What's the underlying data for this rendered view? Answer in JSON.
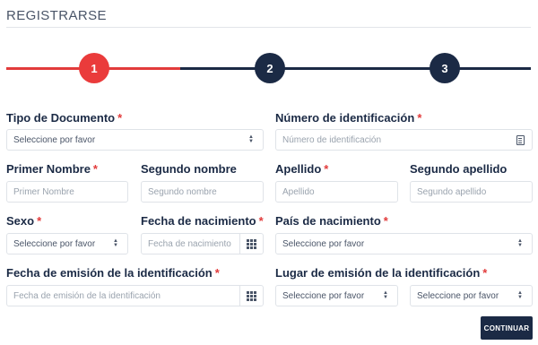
{
  "header": {
    "title": "REGISTRARSE"
  },
  "stepper": {
    "steps": [
      "1",
      "2",
      "3"
    ],
    "current_step": 1
  },
  "required_mark": "*",
  "fields": {
    "tipo_documento": {
      "label": "Tipo de Documento",
      "value": "Seleccione por favor"
    },
    "numero_identificacion": {
      "label": "Número de identificación",
      "placeholder": "Número de identificación"
    },
    "primer_nombre": {
      "label": "Primer Nombre",
      "placeholder": "Primer Nombre"
    },
    "segundo_nombre": {
      "label": "Segundo nombre",
      "placeholder": "Segundo nombre"
    },
    "apellido": {
      "label": "Apellido",
      "placeholder": "Apellido"
    },
    "segundo_apellido": {
      "label": "Segundo apellido",
      "placeholder": "Segundo apellido"
    },
    "sexo": {
      "label": "Sexo",
      "value": "Seleccione por favor"
    },
    "fecha_nacimiento": {
      "label": "Fecha de nacimiento",
      "placeholder": "Fecha de nacimiento"
    },
    "pais_nacimiento": {
      "label": "País de nacimiento",
      "value": "Seleccione por favor"
    },
    "fecha_emision": {
      "label": "Fecha de emisión de la identificación",
      "placeholder": "Fecha de emisión de la identificación"
    },
    "lugar_emision": {
      "label": "Lugar de emisión de la identificación",
      "value_1": "Seleccione por favor",
      "value_2": "Seleccione por favor"
    }
  },
  "actions": {
    "continue_label": "CONTINUAR"
  },
  "colors": {
    "accent_red": "#e23b3b",
    "navy": "#1b2a45"
  },
  "icons": {
    "select": "updown-chevron-icon",
    "calendar": "calendar-grid-icon",
    "id_card": "id-card-icon"
  }
}
